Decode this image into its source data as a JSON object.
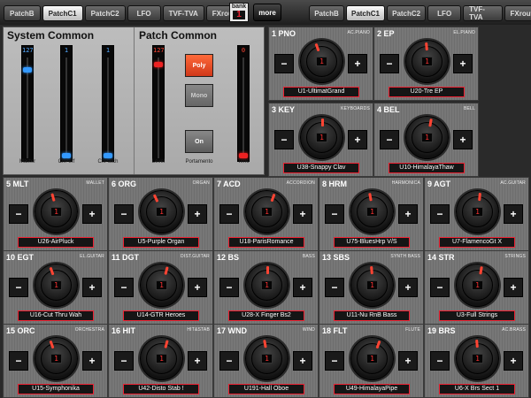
{
  "tabs_left": [
    {
      "label": "PatchB",
      "active": false
    },
    {
      "label": "PatchC1",
      "active": true
    },
    {
      "label": "PatchC2",
      "active": false
    },
    {
      "label": "LFO",
      "active": false
    },
    {
      "label": "TVF-TVA",
      "active": false
    },
    {
      "label": "FXroute",
      "active": false
    }
  ],
  "tabs_right": [
    {
      "label": "PatchB",
      "active": false
    },
    {
      "label": "PatchC1",
      "active": true
    },
    {
      "label": "PatchC2",
      "active": false
    },
    {
      "label": "LFO",
      "active": false
    },
    {
      "label": "TVF-TVA",
      "active": false
    },
    {
      "label": "FXroute",
      "active": false
    }
  ],
  "bank": {
    "label": "bank",
    "value": "1"
  },
  "more_label": "more",
  "system_common": {
    "title": "System Common",
    "faders": [
      {
        "label": "Master",
        "value": "127",
        "level": 0.9
      },
      {
        "label": "ChPerf",
        "value": "1",
        "level": 0.0
      },
      {
        "label": "ChPatch",
        "value": "1",
        "level": 0.0
      }
    ]
  },
  "patch_common": {
    "title": "Patch Common",
    "level": {
      "label": "Level",
      "value": "127",
      "level": 0.95
    },
    "time": {
      "label": "Time",
      "value": "0",
      "level": 0.0
    },
    "poly_label": "Poly",
    "mono_label": "Mono",
    "on_label": "On",
    "portamento_label": "Portamento"
  },
  "parts": [
    {
      "title": "1 PNO",
      "type": "AC.PIANO",
      "patch": "U1-UltimatGrand",
      "digit": "1"
    },
    {
      "title": "2 EP",
      "type": "EL.PIANO",
      "patch": "U20-Tre EP",
      "digit": "1"
    },
    {
      "title": "3 KEY",
      "type": "KEYBOARDS",
      "patch": "U38-Snappy Clav",
      "digit": "1"
    },
    {
      "title": "4 BEL",
      "type": "BELL",
      "patch": "U10-HimalayaThaw",
      "digit": "1"
    },
    {
      "title": "5 MLT",
      "type": "MALLET",
      "patch": "U26-AirPluck",
      "digit": "1"
    },
    {
      "title": "6 ORG",
      "type": "ORGAN",
      "patch": "U5-Purple Organ",
      "digit": "1"
    },
    {
      "title": "7 ACD",
      "type": "ACCORDION",
      "patch": "U18-ParisRomance",
      "digit": "1"
    },
    {
      "title": "8 HRM",
      "type": "HARMONICA",
      "patch": "U75-BluesHrp V/S",
      "digit": "1"
    },
    {
      "title": "9 AGT",
      "type": "AC.GUITAR",
      "patch": "U7-FlamencoGt X",
      "digit": "1"
    },
    {
      "title": "10 EGT",
      "type": "EL.GUITAR",
      "patch": "U16-Cut Thru Wah",
      "digit": "1"
    },
    {
      "title": "11 DGT",
      "type": "DIST.GUITAR",
      "patch": "U14-GTR Heroes",
      "digit": "1"
    },
    {
      "title": "12 BS",
      "type": "BASS",
      "patch": "U28-X Finger Bs2",
      "digit": "1"
    },
    {
      "title": "13 SBS",
      "type": "SYNTH BASS",
      "patch": "U11-Nu RnB Bass",
      "digit": "1"
    },
    {
      "title": "14 STR",
      "type": "STRINGS",
      "patch": "U3-Full Strings",
      "digit": "1"
    },
    {
      "title": "15 ORC",
      "type": "ORCHESTRA",
      "patch": "U15-Symphonika",
      "digit": "1"
    },
    {
      "title": "16 HIT",
      "type": "HIT&STAB",
      "patch": "U42-Disto Stab !",
      "digit": "1"
    },
    {
      "title": "17 WND",
      "type": "WIND",
      "patch": "U191-Hall Oboe",
      "digit": "1"
    },
    {
      "title": "18 FLT",
      "type": "FLUTE",
      "patch": "U49-HimalayaPipe",
      "digit": "1"
    },
    {
      "title": "19 BRS",
      "type": "AC.BRASS",
      "patch": "U6-X Brs Sect 1",
      "digit": "1"
    }
  ],
  "colors": {
    "accent_red": "#ee2233",
    "active_blue": "#3399ff",
    "poly_orange": "#ff6a3a"
  },
  "icons": {
    "minus": "minus-icon",
    "plus": "plus-icon"
  }
}
